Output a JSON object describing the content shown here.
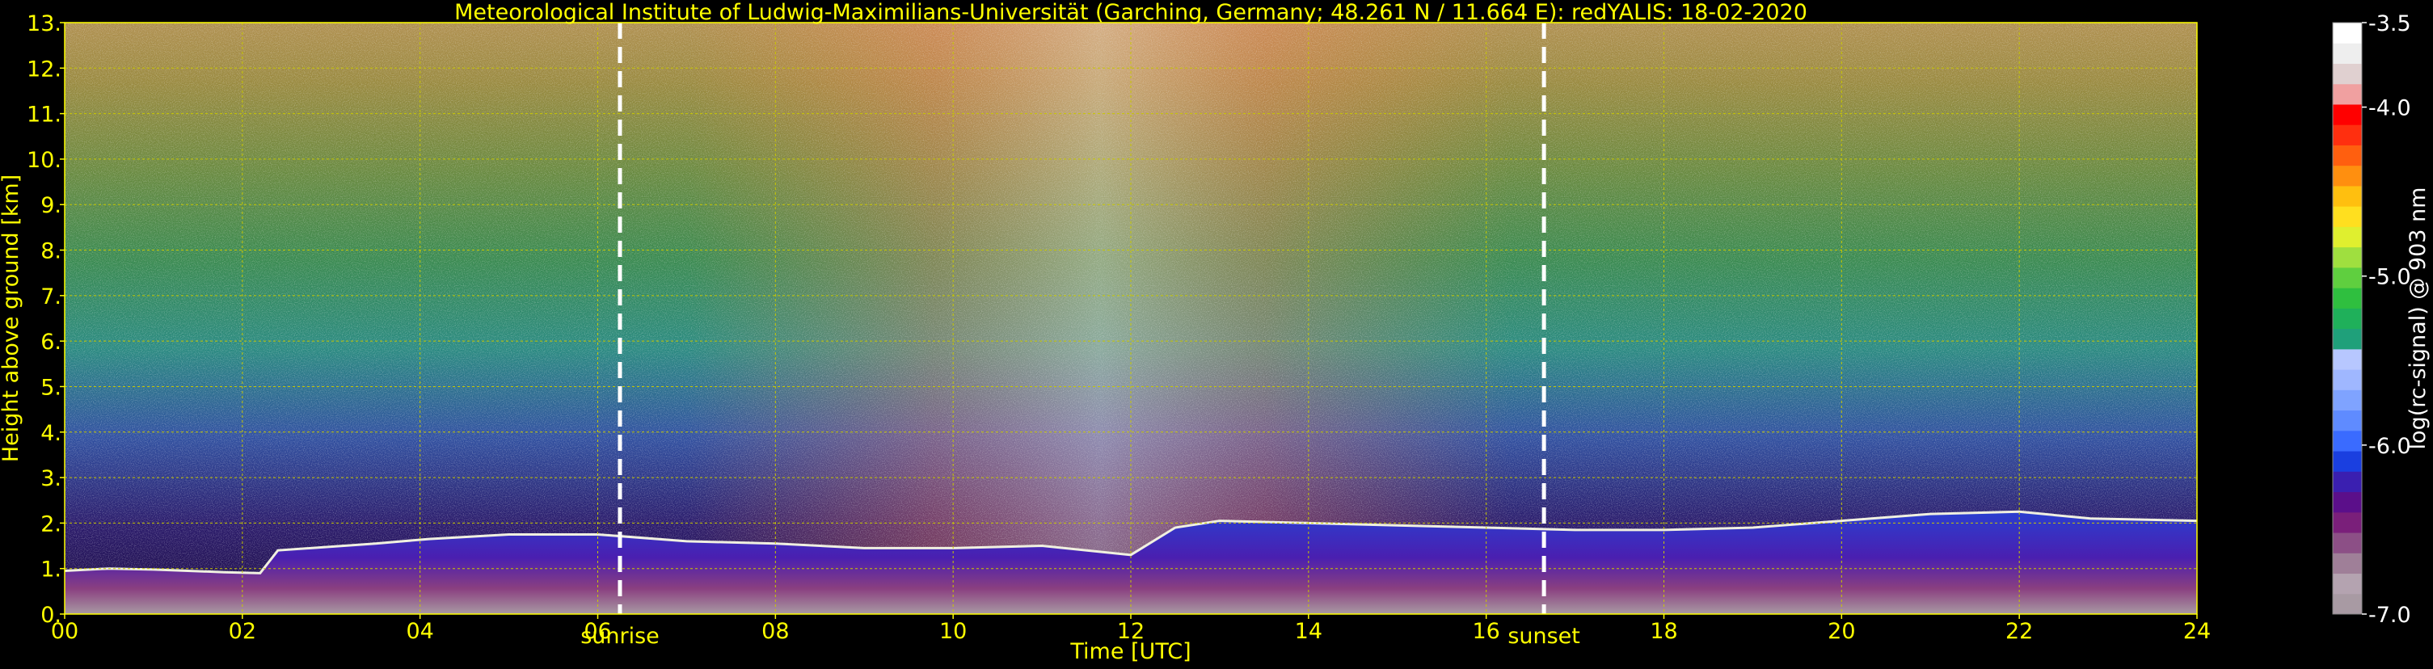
{
  "chart_data": {
    "type": "heatmap",
    "title": "Meteorological Institute of Ludwig-Maximilians-Universität (Garching, Germany; 48.261 N / 11.664 E):    redYALIS: 18-02-2020",
    "xlabel": "Time [UTC]",
    "ylabel": "Height above ground [km]",
    "xlim": [
      0,
      24
    ],
    "ylim": [
      0,
      13
    ],
    "x_ticks": [
      {
        "value": 0,
        "label": "00"
      },
      {
        "value": 2,
        "label": "02"
      },
      {
        "value": 4,
        "label": "04"
      },
      {
        "value": 6,
        "label": "06"
      },
      {
        "value": 8,
        "label": "08"
      },
      {
        "value": 10,
        "label": "10"
      },
      {
        "value": 12,
        "label": "12"
      },
      {
        "value": 14,
        "label": "14"
      },
      {
        "value": 16,
        "label": "16"
      },
      {
        "value": 18,
        "label": "18"
      },
      {
        "value": 20,
        "label": "20"
      },
      {
        "value": 22,
        "label": "22"
      },
      {
        "value": 24,
        "label": "24"
      }
    ],
    "y_ticks": [
      {
        "value": 0,
        "label": "0."
      },
      {
        "value": 1,
        "label": "1."
      },
      {
        "value": 2,
        "label": "2."
      },
      {
        "value": 3,
        "label": "3."
      },
      {
        "value": 4,
        "label": "4."
      },
      {
        "value": 5,
        "label": "5."
      },
      {
        "value": 6,
        "label": "6."
      },
      {
        "value": 7,
        "label": "7."
      },
      {
        "value": 8,
        "label": "8."
      },
      {
        "value": 9,
        "label": "9."
      },
      {
        "value": 10,
        "label": "10."
      },
      {
        "value": 11,
        "label": "11."
      },
      {
        "value": 12,
        "label": "12."
      },
      {
        "value": 13,
        "label": "13."
      }
    ],
    "grid": true,
    "annotations": [
      {
        "x": 6.25,
        "label": "sunrise"
      },
      {
        "x": 16.65,
        "label": "sunset"
      }
    ],
    "colorbar": {
      "label": "log(rc-signal) @ 903 nm",
      "range": [
        -7.0,
        -3.5
      ],
      "ticks": [
        {
          "value": -3.5,
          "label": "-3.5"
        },
        {
          "value": -4.0,
          "label": "-4.0"
        },
        {
          "value": -5.0,
          "label": "-5.0"
        },
        {
          "value": -6.0,
          "label": "-6.0"
        },
        {
          "value": -7.0,
          "label": "-7.0"
        }
      ],
      "colors": [
        "#a89aa3",
        "#b4a3b0",
        "#9f7f98",
        "#8c4f86",
        "#7a1f7a",
        "#5b0f8a",
        "#3a1fb0",
        "#1a3fe0",
        "#3a6bff",
        "#5f8bff",
        "#7fa3ff",
        "#9fb7ff",
        "#b7c7ff",
        "#1fa07a",
        "#1fb05a",
        "#2fbf3f",
        "#5fcf3f",
        "#9fdf3f",
        "#dfef2f",
        "#ffdf1f",
        "#ffbf0f",
        "#ff8f0f",
        "#ff5f0f",
        "#ff2f0f",
        "#ff0000",
        "#f0a0a0",
        "#e0d0d0",
        "#eeeeee",
        "#ffffff"
      ]
    },
    "boundary_layer": [
      {
        "t": 0.0,
        "h": 0.95
      },
      {
        "t": 0.5,
        "h": 1.0
      },
      {
        "t": 1.0,
        "h": 0.98
      },
      {
        "t": 1.8,
        "h": 0.92
      },
      {
        "t": 2.2,
        "h": 0.9
      },
      {
        "t": 2.4,
        "h": 1.4
      },
      {
        "t": 3.5,
        "h": 1.55
      },
      {
        "t": 4.1,
        "h": 1.65
      },
      {
        "t": 5.0,
        "h": 1.75
      },
      {
        "t": 6.0,
        "h": 1.75
      },
      {
        "t": 7.0,
        "h": 1.6
      },
      {
        "t": 8.0,
        "h": 1.55
      },
      {
        "t": 9.0,
        "h": 1.45
      },
      {
        "t": 10.0,
        "h": 1.45
      },
      {
        "t": 11.0,
        "h": 1.5
      },
      {
        "t": 12.0,
        "h": 1.3
      },
      {
        "t": 12.5,
        "h": 1.9
      },
      {
        "t": 13.0,
        "h": 2.05
      },
      {
        "t": 14.0,
        "h": 2.0
      },
      {
        "t": 15.0,
        "h": 1.95
      },
      {
        "t": 16.0,
        "h": 1.9
      },
      {
        "t": 17.0,
        "h": 1.85
      },
      {
        "t": 18.0,
        "h": 1.85
      },
      {
        "t": 19.0,
        "h": 1.9
      },
      {
        "t": 20.0,
        "h": 2.05
      },
      {
        "t": 21.0,
        "h": 2.2
      },
      {
        "t": 22.0,
        "h": 2.25
      },
      {
        "t": 22.8,
        "h": 2.1
      },
      {
        "t": 24.0,
        "h": 2.05
      }
    ]
  },
  "colors": {
    "axis_text": "#ffff00",
    "grid": "#c8c800",
    "marker_line": "#ffffff",
    "background": "#000000"
  }
}
